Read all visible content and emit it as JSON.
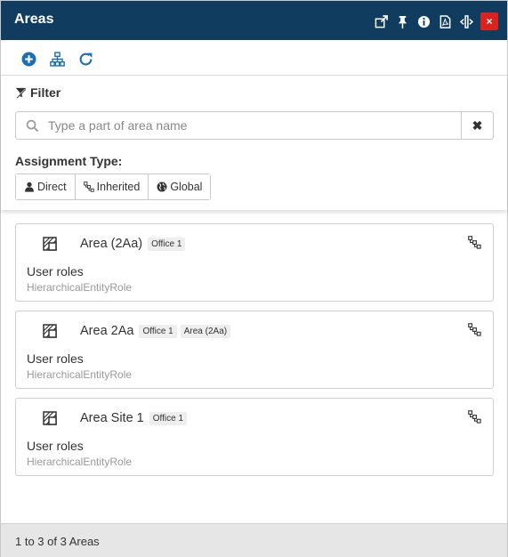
{
  "header": {
    "title": "Areas",
    "icons": [
      "external-link-icon",
      "pin-icon",
      "info-icon",
      "pdf-icon",
      "expand-width-icon",
      "close-icon"
    ],
    "close_glyph": "×",
    "bg_color": "#0f3c5f",
    "close_color": "#d9231c"
  },
  "toolbar": {
    "icons": [
      "add-icon",
      "hierarchy-icon",
      "refresh-icon"
    ],
    "icon_color": "#1a6eb5"
  },
  "filter": {
    "title": "Filter",
    "search_placeholder": "Type a part of area name",
    "search_value": "",
    "clear_glyph": "✖",
    "assignment_label": "Assignment Type:",
    "assignment_buttons": [
      "Direct",
      "Inherited",
      "Global"
    ]
  },
  "items": [
    {
      "name": "Area (2Aa)",
      "tags": [
        "Office 1"
      ],
      "role": "User roles",
      "role_type": "HierarchicalEntityRole"
    },
    {
      "name": "Area 2Aa",
      "tags": [
        "Office 1",
        "Area (2Aa)"
      ],
      "role": "User roles",
      "role_type": "HierarchicalEntityRole"
    },
    {
      "name": "Area Site 1",
      "tags": [
        "Office 1"
      ],
      "role": "User roles",
      "role_type": "HierarchicalEntityRole"
    }
  ],
  "footer": {
    "summary": "1 to 3 of 3 Areas"
  }
}
